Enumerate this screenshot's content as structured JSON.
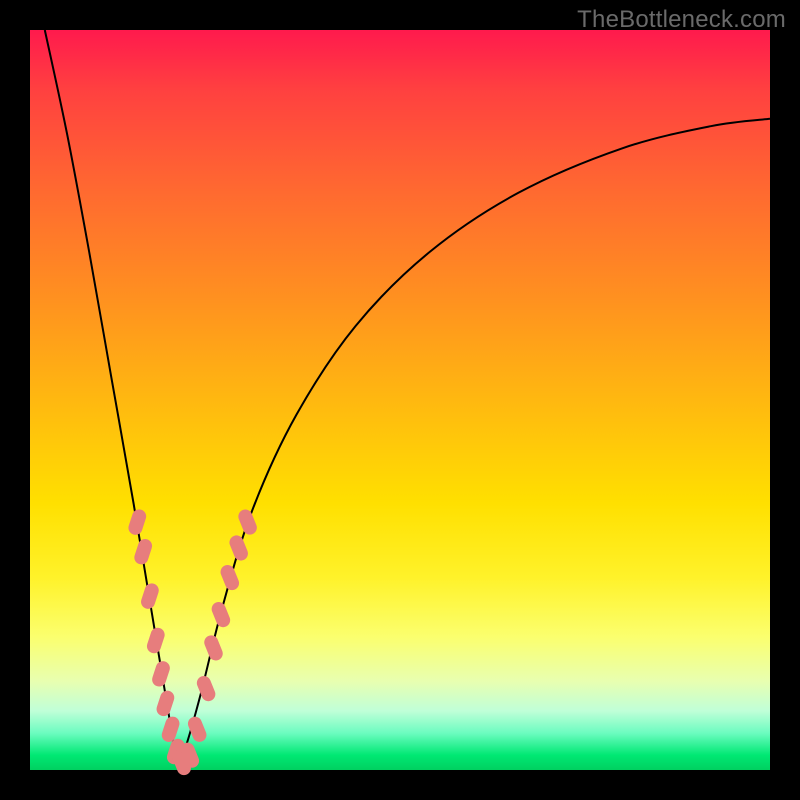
{
  "watermark": "TheBottleneck.com",
  "colors": {
    "frame_bg_top": "#ff1a4d",
    "frame_bg_bottom": "#00d060",
    "border": "#000000",
    "curve": "#000000",
    "bead": "#e77d7d",
    "watermark": "#6a6a6a"
  },
  "chart_data": {
    "type": "line",
    "title": "",
    "xlabel": "",
    "ylabel": "",
    "xlim": [
      0,
      1
    ],
    "ylim": [
      0,
      1
    ],
    "note": "Axes are unlabelled; values are normalized 0–1 where 0 is bottom-left of the colored plot area. The curve is a V-shaped bottleneck curve with minimum near x≈0.20.",
    "series": [
      {
        "name": "bottleneck-curve",
        "x": [
          0.02,
          0.05,
          0.08,
          0.11,
          0.14,
          0.17,
          0.19,
          0.2,
          0.21,
          0.23,
          0.26,
          0.3,
          0.36,
          0.44,
          0.54,
          0.66,
          0.8,
          0.92,
          1.0
        ],
        "y": [
          1.0,
          0.86,
          0.7,
          0.53,
          0.36,
          0.18,
          0.06,
          0.01,
          0.03,
          0.1,
          0.22,
          0.35,
          0.48,
          0.6,
          0.7,
          0.78,
          0.84,
          0.87,
          0.88
        ]
      }
    ],
    "markers": {
      "name": "highlight-beads",
      "shape": "rounded-rect",
      "points_xy": [
        [
          0.145,
          0.335
        ],
        [
          0.153,
          0.295
        ],
        [
          0.162,
          0.235
        ],
        [
          0.17,
          0.175
        ],
        [
          0.177,
          0.13
        ],
        [
          0.183,
          0.09
        ],
        [
          0.19,
          0.055
        ],
        [
          0.197,
          0.025
        ],
        [
          0.205,
          0.01
        ],
        [
          0.216,
          0.02
        ],
        [
          0.226,
          0.055
        ],
        [
          0.238,
          0.11
        ],
        [
          0.248,
          0.165
        ],
        [
          0.258,
          0.21
        ],
        [
          0.27,
          0.26
        ],
        [
          0.282,
          0.3
        ],
        [
          0.294,
          0.335
        ]
      ]
    }
  }
}
